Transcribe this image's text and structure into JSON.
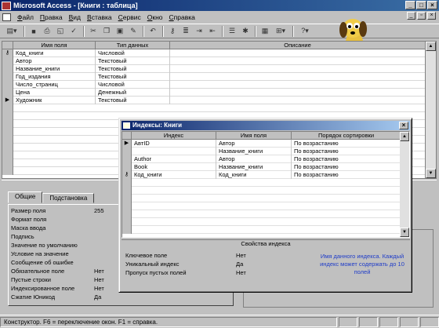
{
  "app": {
    "title": "Microsoft Access - [Книги : таблица]"
  },
  "menu": [
    "Файл",
    "Правка",
    "Вид",
    "Вставка",
    "Сервис",
    "Окно",
    "Справка"
  ],
  "design_grid": {
    "columns": [
      "Имя поля",
      "Тип данных",
      "Описание"
    ],
    "rows": [
      {
        "name": "Код_книги",
        "type": "Числовой",
        "key": true
      },
      {
        "name": "Автор",
        "type": "Текстовый"
      },
      {
        "name": "Название_книги",
        "type": "Текстовый"
      },
      {
        "name": "Год_издания",
        "type": "Текстовый"
      },
      {
        "name": "Число_страниц",
        "type": "Числовой"
      },
      {
        "name": "Цена",
        "type": "Денежный"
      },
      {
        "name": "Художник",
        "type": "Текстовый",
        "current": true
      }
    ]
  },
  "field_properties": {
    "tabs": [
      "Общие",
      "Подстановка"
    ],
    "rows": [
      {
        "label": "Размер поля",
        "value": "255"
      },
      {
        "label": "Формат поля",
        "value": ""
      },
      {
        "label": "Маска ввода",
        "value": ""
      },
      {
        "label": "Подпись",
        "value": ""
      },
      {
        "label": "Значение по умолчанию",
        "value": ""
      },
      {
        "label": "Условие на значение",
        "value": ""
      },
      {
        "label": "Сообщение об ошибке",
        "value": ""
      },
      {
        "label": "Обязательное поле",
        "value": "Нет"
      },
      {
        "label": "Пустые строки",
        "value": "Нет"
      },
      {
        "label": "Индексированное поле",
        "value": "Нет"
      },
      {
        "label": "Сжатие Юникод",
        "value": "Да"
      }
    ]
  },
  "index_dialog": {
    "title": "Индексы: Книги",
    "columns": [
      "Индекс",
      "Имя поля",
      "Порядок сортировки"
    ],
    "rows": [
      {
        "index": "AвтID",
        "field": "Автор",
        "order": "По возрастанию",
        "current": true
      },
      {
        "index": "",
        "field": "Название_книги",
        "order": "По возрастанию"
      },
      {
        "index": "Author",
        "field": "Автор",
        "order": "По возрастанию"
      },
      {
        "index": "Book",
        "field": "Название_книги",
        "order": "По возрастанию"
      },
      {
        "index": "Код_книги",
        "field": "Код_книги",
        "order": "По возрастанию",
        "key": true
      }
    ],
    "properties_title": "Свойства индекса",
    "properties": [
      {
        "label": "Ключевое поле",
        "value": "Нет"
      },
      {
        "label": "Уникальный индекс",
        "value": "Да"
      },
      {
        "label": "Пропуск пустых полей",
        "value": "Нет"
      }
    ],
    "hint": "Имя данного индекса. Каждый индекс может содержать до 10 полей"
  },
  "status": {
    "text": "Конструктор.  F6 = переключение окон.  F1 = справка."
  },
  "icons": [
    "view-icon",
    "save-icon",
    "print-icon",
    "preview-icon",
    "spelling-icon",
    "cut-icon",
    "copy-icon",
    "paste-icon",
    "format-painter-icon",
    "undo-icon",
    "primary-key-icon",
    "indexes-icon",
    "insert-row-icon",
    "delete-row-icon",
    "properties-icon",
    "build-icon",
    "database-window-icon",
    "new-object-icon",
    "help-icon"
  ],
  "colors": {
    "title_bar": "#0a246a",
    "window_bg": "#c0c0c0",
    "hint_text": "#1f3cc8"
  }
}
